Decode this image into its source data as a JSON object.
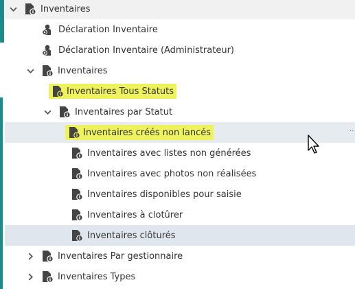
{
  "tree": {
    "root": {
      "label": "Inventaires",
      "icon": "doc-info-icon",
      "toggle": "chevron-down-icon"
    },
    "declaration": {
      "label": "Déclaration Inventaire",
      "icon": "gear-user-icon"
    },
    "declaration_admin": {
      "label": "Déclaration Inventaire (Administrateur)",
      "icon": "gear-user-icon"
    },
    "inventaires": {
      "label": "Inventaires",
      "icon": "doc-info-icon",
      "toggle": "chevron-down-icon"
    },
    "tous_statuts": {
      "label": "Inventaires Tous Statuts",
      "icon": "doc-info-icon"
    },
    "par_statut": {
      "label": "Inventaires par Statut",
      "icon": "doc-info-icon",
      "toggle": "chevron-down-icon"
    },
    "statuses": [
      {
        "label": "Inventaires créés non lancés",
        "icon": "doc-info-icon"
      },
      {
        "label": "Inventaires avec listes non générées",
        "icon": "doc-info-icon"
      },
      {
        "label": "Inventaires avec photos non réalisées",
        "icon": "doc-info-icon"
      },
      {
        "label": "Inventaires disponibles pour saisie",
        "icon": "doc-info-icon"
      },
      {
        "label": "Inventaires à clotûrer",
        "icon": "doc-info-icon"
      },
      {
        "label": "Inventaires clôturés",
        "icon": "doc-info-icon"
      }
    ],
    "par_gestionnaire": {
      "label": "Inventaires Par gestionnaire",
      "icon": "doc-info-icon",
      "toggle": "chevron-right-icon"
    },
    "types": {
      "label": "Inventaires Types",
      "icon": "doc-info-icon",
      "toggle": "chevron-right-icon"
    }
  },
  "colors": {
    "accent": "#1e8a8a",
    "highlight": "#eef25c",
    "selected_row": "#dfe6ed",
    "icon": "#444444"
  }
}
